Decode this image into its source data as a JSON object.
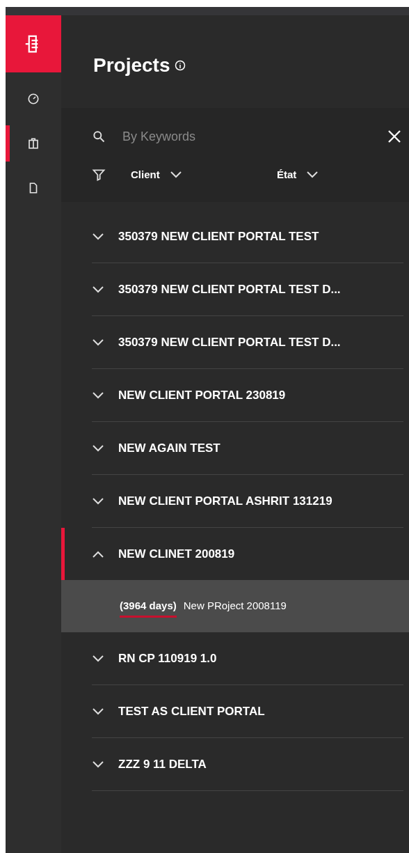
{
  "sidebar": {
    "items": [
      {
        "kind": "gauge",
        "selected": false
      },
      {
        "kind": "clipboard",
        "selected": true
      },
      {
        "kind": "document",
        "selected": false
      }
    ]
  },
  "header": {
    "title": "Projects"
  },
  "search": {
    "placeholder": "By Keywords"
  },
  "filters": [
    {
      "label": "Client"
    },
    {
      "label": "État"
    }
  ],
  "projects": [
    {
      "name": "350379 NEW CLIENT PORTAL TEST",
      "expanded": false
    },
    {
      "name": "350379 NEW CLIENT PORTAL TEST D...",
      "expanded": false
    },
    {
      "name": "350379 NEW CLIENT PORTAL TEST D...",
      "expanded": false
    },
    {
      "name": "NEW CLIENT PORTAL 230819",
      "expanded": false
    },
    {
      "name": "NEW AGAIN TEST",
      "expanded": false
    },
    {
      "name": "NEW CLIENT PORTAL ASHRIT 131219",
      "expanded": false
    },
    {
      "name": "NEW CLINET 200819",
      "expanded": true,
      "children": [
        {
          "days": "(3964 days)",
          "name": "New PRoject 2008119"
        }
      ]
    },
    {
      "name": "RN CP 110919 1.0",
      "expanded": false
    },
    {
      "name": "TEST AS CLIENT PORTAL",
      "expanded": false
    },
    {
      "name": "ZZZ 9 11 DELTA",
      "expanded": false
    }
  ]
}
